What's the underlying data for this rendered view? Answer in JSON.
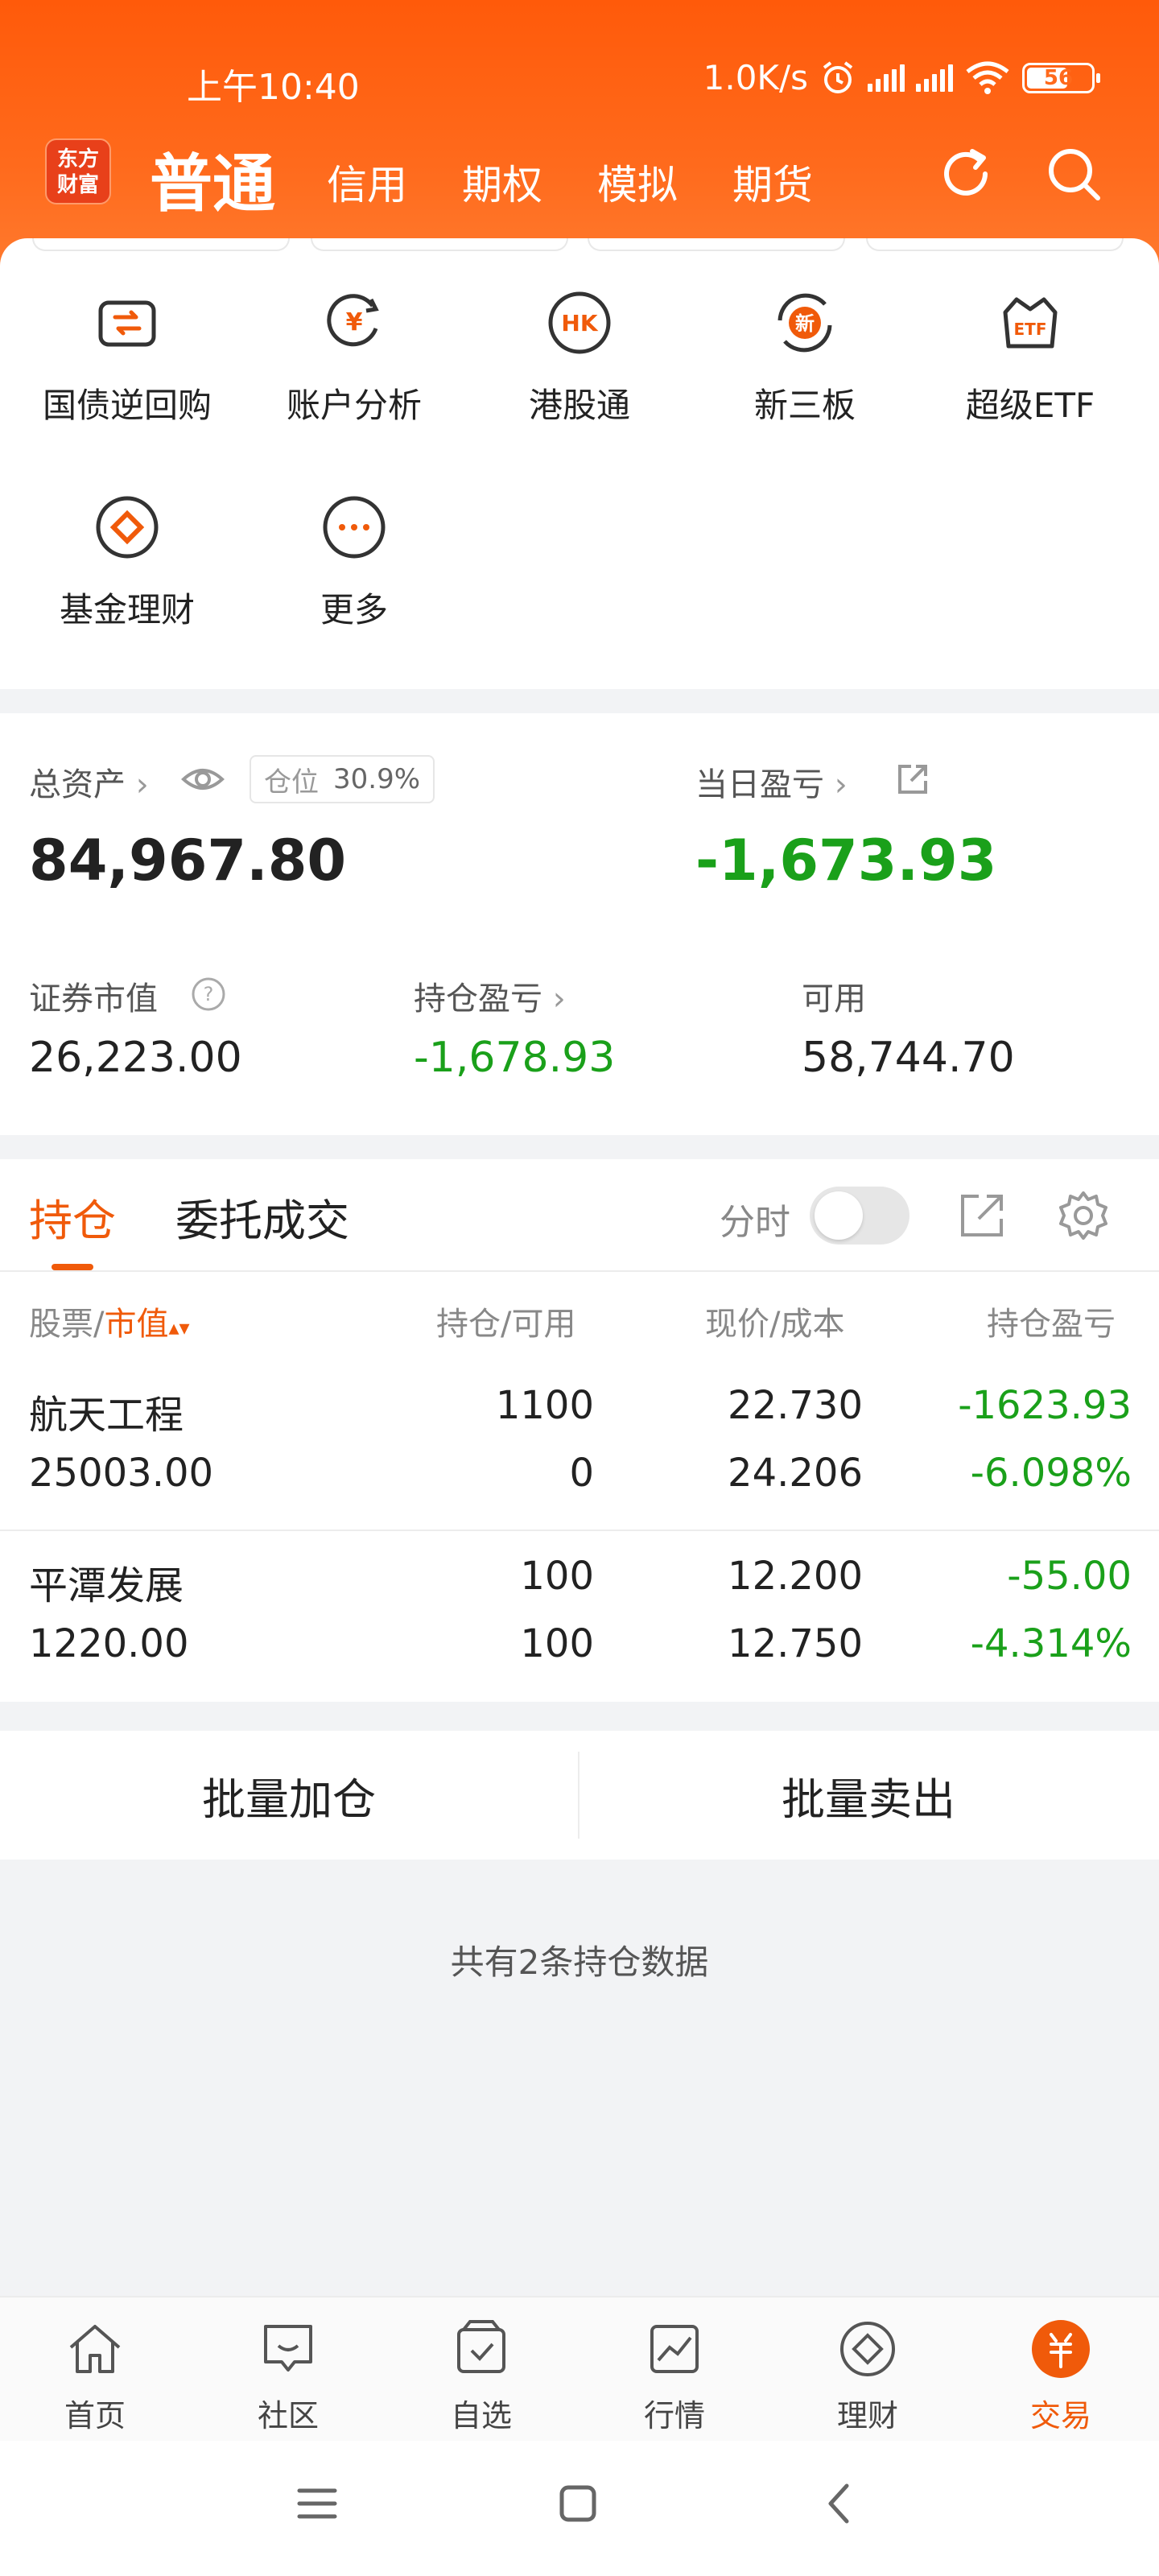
{
  "status": {
    "time": "上午10:40",
    "speed": "1.0K/s",
    "battery": "56"
  },
  "header": {
    "logo_line1": "东方",
    "logo_line2": "财富",
    "tabs": [
      "普通",
      "信用",
      "期权",
      "模拟",
      "期货"
    ],
    "icons": [
      "refresh-icon",
      "search-icon"
    ]
  },
  "quick": [
    {
      "label": "国债逆回购",
      "icon": "repo-icon"
    },
    {
      "label": "账户分析",
      "icon": "account-analysis-icon"
    },
    {
      "label": "港股通",
      "icon": "hk-icon"
    },
    {
      "label": "新三板",
      "icon": "new-three-board-icon"
    },
    {
      "label": "超级ETF",
      "icon": "etf-icon"
    },
    {
      "label": "基金理财",
      "icon": "fund-icon"
    },
    {
      "label": "更多",
      "icon": "more-icon"
    }
  ],
  "assets": {
    "total_label": "总资产",
    "ratio_label": "仓位",
    "ratio_value": "30.9%",
    "total_value": "84,967.80",
    "daily_pnl_label": "当日盈亏",
    "daily_pnl_value": "-1,673.93",
    "market_value_label": "证券市值",
    "market_value": "26,223.00",
    "position_pnl_label": "持仓盈亏",
    "position_pnl_value": "-1,678.93",
    "available_label": "可用",
    "available_value": "58,744.70"
  },
  "holdings": {
    "tab_active": "持仓",
    "tab_other": "委托成交",
    "fenshi": "分时",
    "headers": {
      "stock": "股票/",
      "stock_accent": "市值",
      "position": "持仓/可用",
      "price": "现价/成本",
      "pnl": "持仓盈亏"
    },
    "rows": [
      {
        "name": "航天工程",
        "mv": "25003.00",
        "pos": "1100",
        "avail": "0",
        "price": "22.730",
        "cost": "24.206",
        "pnl": "-1623.93",
        "pnl_pct": "-6.098%"
      },
      {
        "name": "平潭发展",
        "mv": "1220.00",
        "pos": "100",
        "avail": "100",
        "price": "12.200",
        "cost": "12.750",
        "pnl": "-55.00",
        "pnl_pct": "-4.314%"
      }
    ],
    "batch_add": "批量加仓",
    "batch_sell": "批量卖出",
    "count_text": "共有2条持仓数据"
  },
  "bottom_nav": [
    {
      "label": "首页",
      "icon": "home-icon"
    },
    {
      "label": "社区",
      "icon": "community-icon"
    },
    {
      "label": "自选",
      "icon": "watchlist-icon"
    },
    {
      "label": "行情",
      "icon": "market-icon"
    },
    {
      "label": "理财",
      "icon": "wealth-icon"
    },
    {
      "label": "交易",
      "icon": "trade-icon"
    }
  ],
  "colors": {
    "brand": "#ff6a1c",
    "accent": "#f05a0a",
    "loss": "#1aa01a"
  }
}
